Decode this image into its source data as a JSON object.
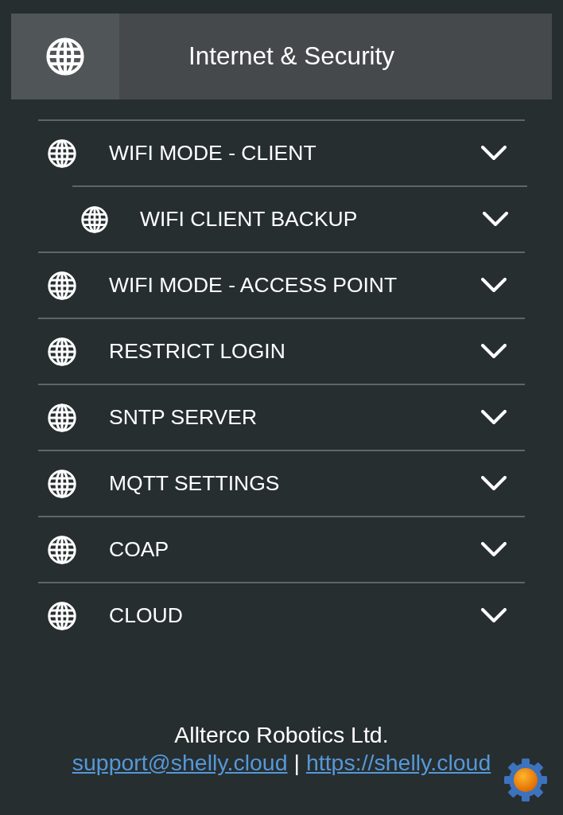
{
  "header": {
    "title": "Internet & Security"
  },
  "sections": [
    {
      "label": "WIFI MODE - CLIENT",
      "expanded": false,
      "children": [
        {
          "label": "WIFI CLIENT BACKUP",
          "expanded": false
        }
      ]
    },
    {
      "label": "WIFI MODE - ACCESS POINT",
      "expanded": false
    },
    {
      "label": "RESTRICT LOGIN",
      "expanded": false
    },
    {
      "label": "SNTP SERVER",
      "expanded": false
    },
    {
      "label": "MQTT SETTINGS",
      "expanded": false
    },
    {
      "label": "COAP",
      "expanded": false
    },
    {
      "label": "CLOUD",
      "expanded": false
    }
  ],
  "footer": {
    "company": "Allterco Robotics Ltd.",
    "separator": "|",
    "links": [
      "support@shelly.cloud",
      "https://shelly.cloud"
    ]
  }
}
